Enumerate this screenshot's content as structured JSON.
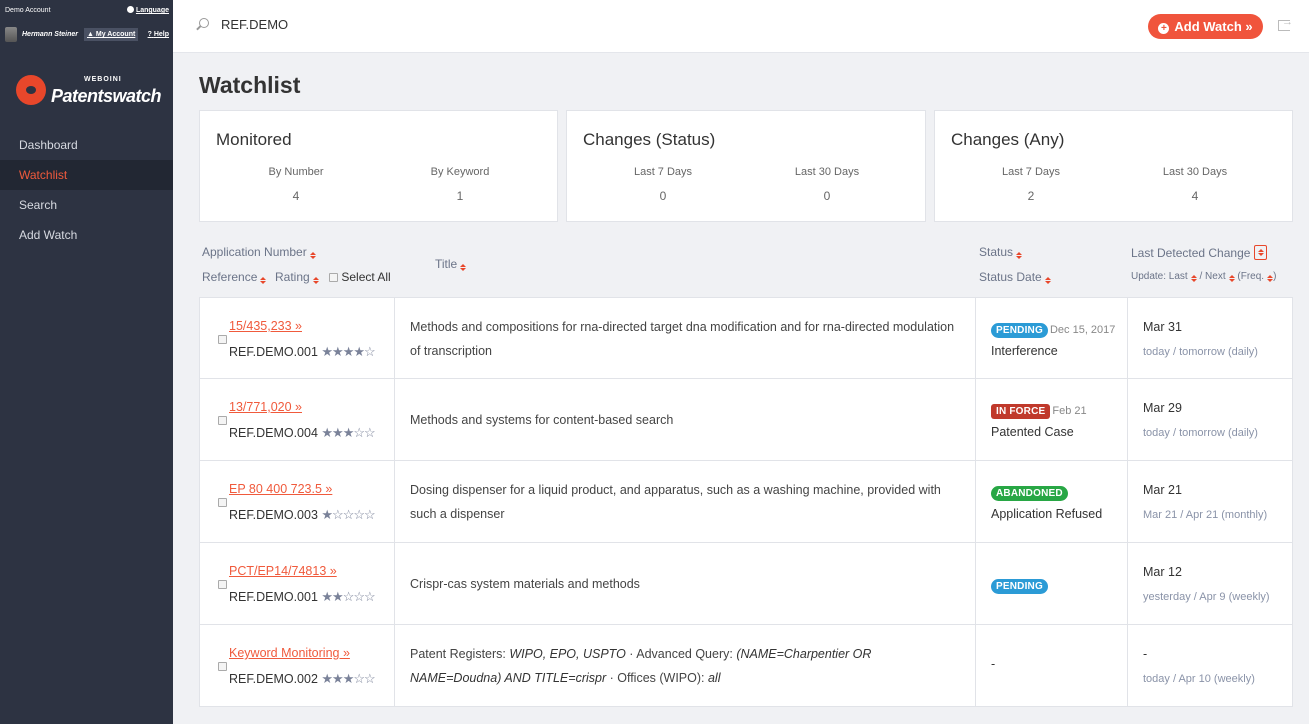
{
  "account": {
    "label": "Demo Account",
    "language": "Language",
    "user_name": "Hermann Steiner",
    "my_account": "My Account",
    "help": "Help"
  },
  "logo": {
    "small": "WEBOINI",
    "big": "Patentswatch"
  },
  "nav": [
    {
      "label": "Dashboard",
      "active": false
    },
    {
      "label": "Watchlist",
      "active": true
    },
    {
      "label": "Search",
      "active": false
    },
    {
      "label": "Add Watch",
      "active": false
    }
  ],
  "search": {
    "value": "REF.DEMO"
  },
  "add_watch_label": "Add Watch »",
  "page_title": "Watchlist",
  "cards": [
    {
      "title": "Monitored",
      "stats": [
        {
          "label": "By Number",
          "value": "4"
        },
        {
          "label": "By Keyword",
          "value": "1"
        }
      ]
    },
    {
      "title": "Changes (Status)",
      "stats": [
        {
          "label": "Last 7 Days",
          "value": "0"
        },
        {
          "label": "Last 30 Days",
          "value": "0"
        }
      ]
    },
    {
      "title": "Changes (Any)",
      "stats": [
        {
          "label": "Last 7 Days",
          "value": "2"
        },
        {
          "label": "Last 30 Days",
          "value": "4"
        }
      ]
    }
  ],
  "table_header": {
    "app_number": "Application Number",
    "reference": "Reference",
    "rating": "Rating",
    "select_all": "Select All",
    "title": "Title",
    "status": "Status",
    "status_date": "Status Date",
    "last_change": "Last Detected Change",
    "update_prefix": "Update: Last",
    "update_next": "/ Next",
    "update_freq": "(Freq."
  },
  "rows": [
    {
      "app": "15/435,233 »",
      "ref": "REF.DEMO.001",
      "stars": "★★★★☆",
      "title": "Methods and compositions for rna-directed target dna modification and for rna-directed modulation of transcription",
      "badge": "PENDING",
      "badge_type": "pending",
      "status_date": "Dec 15, 2017",
      "status": "Interference",
      "change": "Mar 31",
      "update": "today / tomorrow (daily)"
    },
    {
      "app": "13/771,020 »",
      "ref": "REF.DEMO.004",
      "stars": "★★★☆☆",
      "title": "Methods and systems for content-based search",
      "badge": "IN FORCE",
      "badge_type": "inforce",
      "status_date": "Feb 21",
      "status": "Patented Case",
      "change": "Mar 29",
      "update": "today / tomorrow (daily)"
    },
    {
      "app": "EP 80 400 723.5 »",
      "ref": "REF.DEMO.003",
      "stars": "★☆☆☆☆",
      "title": "Dosing dispenser for a liquid product, and apparatus, such as a washing machine, provided with such a dispenser",
      "badge": "ABANDONED",
      "badge_type": "abandoned",
      "status_date": "",
      "status": "Application Refused",
      "change": "Mar 21",
      "update": "Mar 21 / Apr 21 (monthly)"
    },
    {
      "app": "PCT/EP14/74813 »",
      "ref": "REF.DEMO.001",
      "stars": "★★☆☆☆",
      "title": "Crispr-cas system materials and methods",
      "badge": "PENDING",
      "badge_type": "pending",
      "status_date": "",
      "status": "",
      "change": "Mar 12",
      "update": "yesterday / Apr 9 (weekly)"
    }
  ],
  "keyword_row": {
    "app": "Keyword Monitoring »",
    "ref": "REF.DEMO.002",
    "stars": "★★★☆☆",
    "t1": "Patent Registers: ",
    "t2": "WIPO, EPO, USPTO",
    "t3": " · Advanced Query: ",
    "t4": "(NAME=Charpentier OR NAME=Doudna) AND TITLE=crispr",
    "t5": " · Offices (WIPO): ",
    "t6": "all",
    "status": "-",
    "change": "-",
    "update": "today / Apr 10 (weekly)"
  },
  "colors": {
    "sidebar": "#2d3342",
    "accent": "#f05a3c",
    "pending": "#2b9bd6",
    "in_force": "#c0392b",
    "abandoned": "#28a745"
  }
}
